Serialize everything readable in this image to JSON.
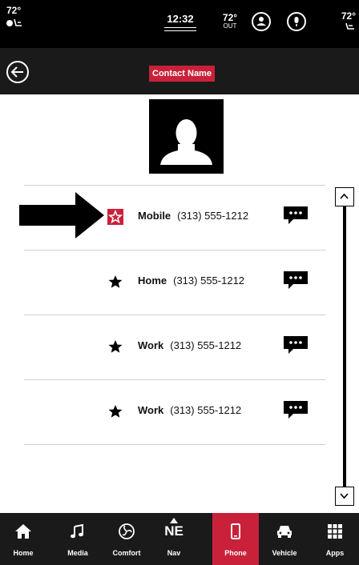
{
  "status": {
    "temp_left": "72°",
    "clock": "12:32",
    "temp_out_value": "72°",
    "temp_out_label": "OUT",
    "temp_right": "72°"
  },
  "header": {
    "title": "Contact Name"
  },
  "contacts": [
    {
      "type": "Mobile",
      "number": "(313) 555-1212",
      "favorite": true
    },
    {
      "type": "Home",
      "number": "(313) 555-1212",
      "favorite": false
    },
    {
      "type": "Work",
      "number": "(313) 555-1212",
      "favorite": false
    },
    {
      "type": "Work",
      "number": "(313) 555-1212",
      "favorite": false
    }
  ],
  "nav": {
    "items": [
      {
        "label": "Home",
        "icon": "home-icon"
      },
      {
        "label": "Media",
        "icon": "music-note-icon"
      },
      {
        "label": "Comfort",
        "icon": "fan-icon"
      },
      {
        "label": "Nav",
        "icon": "compass-ne-icon",
        "glyph": "NE"
      },
      {
        "label": "Phone",
        "icon": "phone-icon"
      },
      {
        "label": "Vehicle",
        "icon": "car-icon"
      },
      {
        "label": "Apps",
        "icon": "grid-icon"
      }
    ],
    "active": "Phone"
  },
  "colors": {
    "accent": "#c9213a",
    "bar": "#1a1a1a",
    "status_bar": "#000000"
  }
}
